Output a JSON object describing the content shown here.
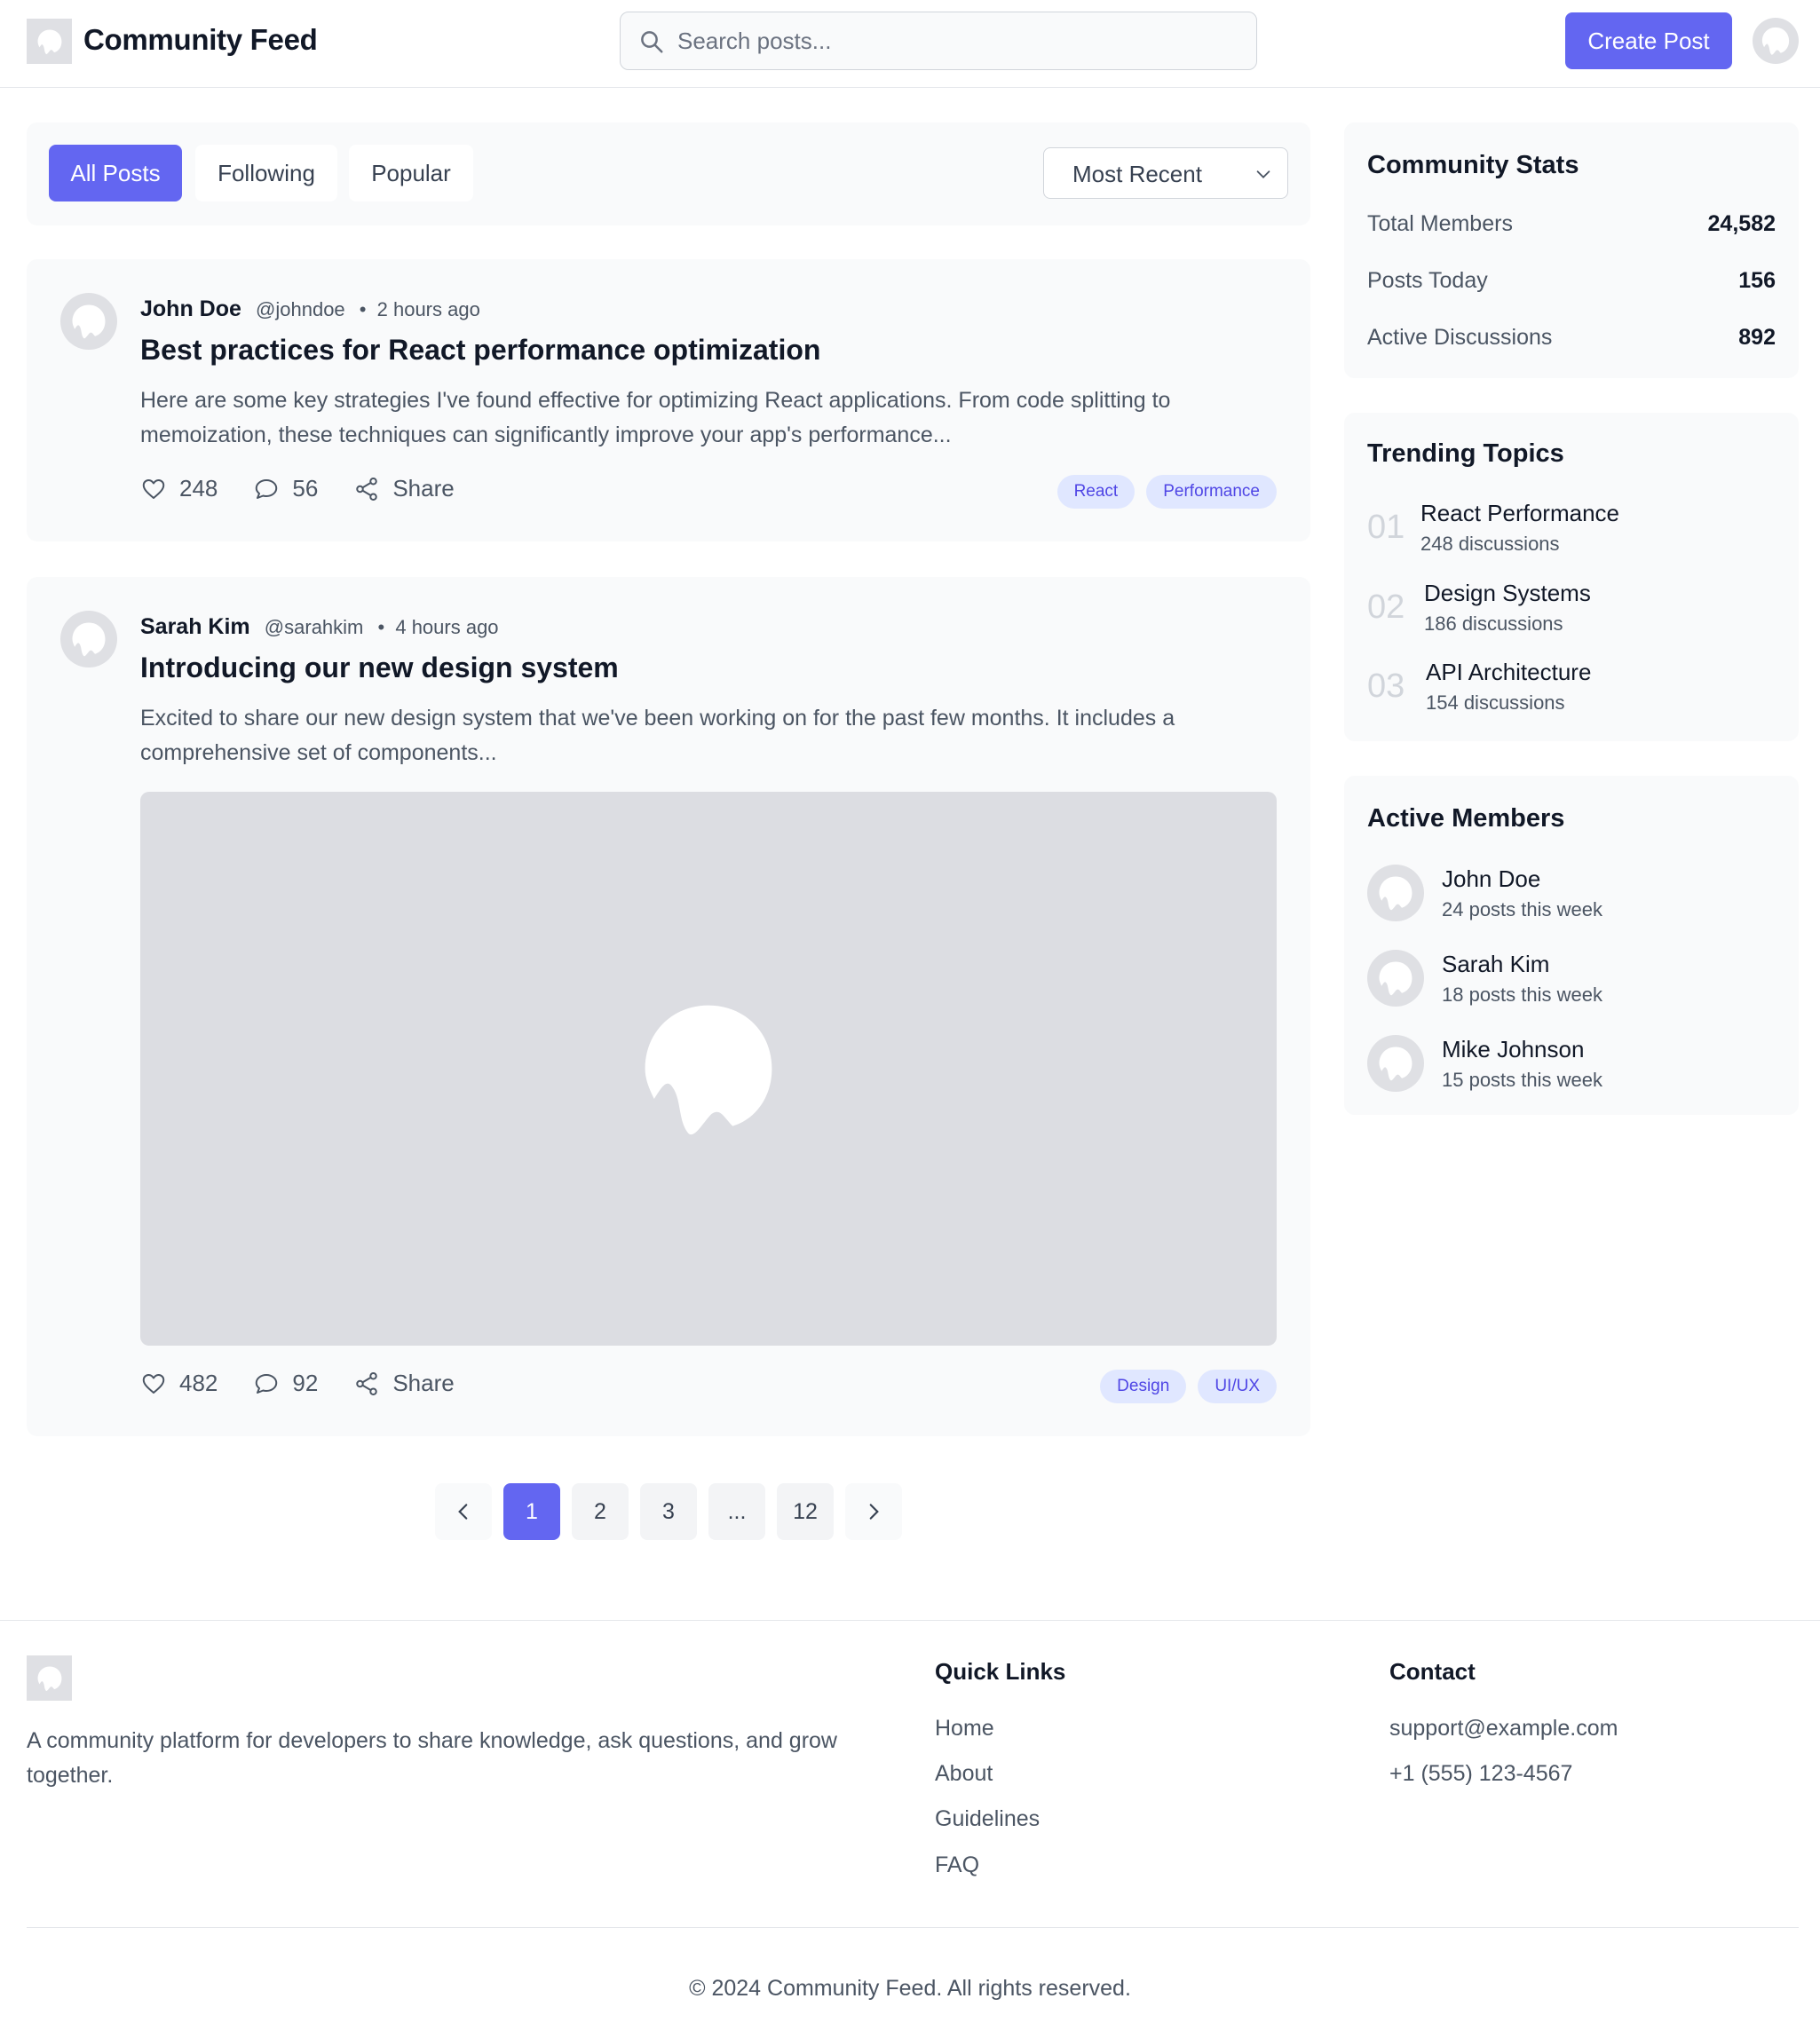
{
  "header": {
    "brand": "Community Feed",
    "search_placeholder": "Search posts...",
    "create_label": "Create Post"
  },
  "filters": {
    "tabs": [
      "All Posts",
      "Following",
      "Popular"
    ],
    "active_tab": "All Posts",
    "sort_value": "Most Recent"
  },
  "posts": [
    {
      "author": "John Doe",
      "handle": "@johndoe",
      "time": "2 hours ago",
      "title": "Best practices for React performance optimization",
      "excerpt": "Here are some key strategies I've found effective for optimizing React applications. From code splitting to memoization, these techniques can significantly improve your app's performance...",
      "likes": "248",
      "comments": "56",
      "share_label": "Share",
      "tags": [
        "React",
        "Performance"
      ]
    },
    {
      "author": "Sarah Kim",
      "handle": "@sarahkim",
      "time": "4 hours ago",
      "title": "Introducing our new design system",
      "excerpt": "Excited to share our new design system that we've been working on for the past few months. It includes a comprehensive set of components...",
      "likes": "482",
      "comments": "92",
      "share_label": "Share",
      "tags": [
        "Design",
        "UI/UX"
      ]
    }
  ],
  "pagination": {
    "pages": [
      "1",
      "2",
      "3",
      "...",
      "12"
    ],
    "current": "1"
  },
  "stats": {
    "title": "Community Stats",
    "rows": [
      {
        "label": "Total Members",
        "value": "24,582"
      },
      {
        "label": "Posts Today",
        "value": "156"
      },
      {
        "label": "Active Discussions",
        "value": "892"
      }
    ]
  },
  "trending": {
    "title": "Trending Topics",
    "items": [
      {
        "num": "01",
        "name": "React Performance",
        "count": "248 discussions"
      },
      {
        "num": "02",
        "name": "Design Systems",
        "count": "186 discussions"
      },
      {
        "num": "03",
        "name": "API Architecture",
        "count": "154 discussions"
      }
    ]
  },
  "members": {
    "title": "Active Members",
    "items": [
      {
        "name": "John Doe",
        "sub": "24 posts this week"
      },
      {
        "name": "Sarah Kim",
        "sub": "18 posts this week"
      },
      {
        "name": "Mike Johnson",
        "sub": "15 posts this week"
      }
    ]
  },
  "footer": {
    "description": "A community platform for developers to share knowledge, ask questions, and grow together.",
    "quick_links_title": "Quick Links",
    "quick_links": [
      "Home",
      "About",
      "Guidelines",
      "FAQ"
    ],
    "contact_title": "Contact",
    "email": "support@example.com",
    "phone": "+1 (555) 123-4567",
    "copyright": "© 2024 Community Feed. All rights reserved."
  },
  "colors": {
    "accent": "#6366f1",
    "tag_bg": "#e0e7ff",
    "placeholder": "#dfe0e4"
  },
  "icons": {
    "search": "search-icon",
    "like": "heart-icon",
    "comment": "comment-icon",
    "share": "share-icon",
    "sort": "chevron-down-icon",
    "prev": "chevron-left-icon",
    "next": "chevron-right-icon",
    "placeholder": "image-placeholder-icon"
  }
}
